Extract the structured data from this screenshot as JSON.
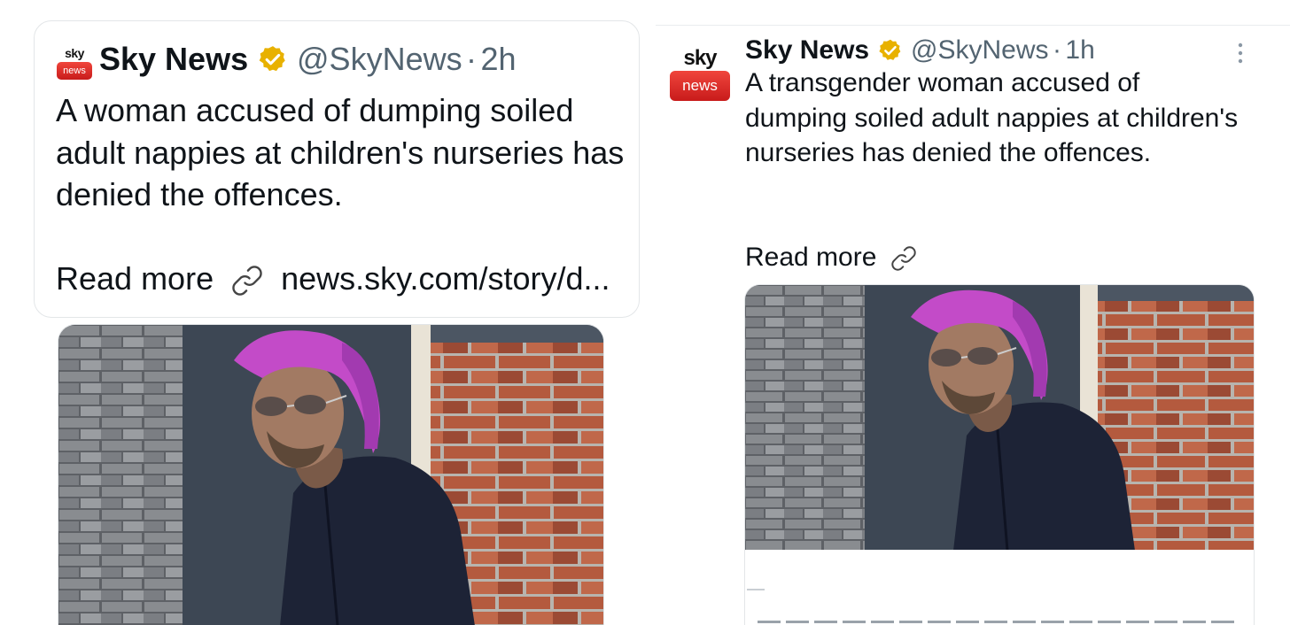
{
  "left_tweet": {
    "logo": {
      "top": "sky",
      "bottom": "news"
    },
    "name": "Sky News",
    "verified_icon": "verified-badge-icon",
    "handle": "@SkyNews",
    "separator": "·",
    "time": "2h",
    "text": "A woman accused of dumping soiled adult nappies at children's nurseries has denied the offences.",
    "read_more": "Read more",
    "link_icon": "link-icon",
    "link_text": "news.sky.com/story/d..."
  },
  "right_tweet": {
    "logo": {
      "top": "sky",
      "bottom": "news"
    },
    "name": "Sky News",
    "verified_icon": "verified-badge-icon",
    "handle": "@SkyNews",
    "separator": "·",
    "time": "1h",
    "more_icon": "more-options-icon",
    "text": "A transgender woman accused of dumping soiled adult nappies at children's nurseries has denied the offences.",
    "read_more": "Read more",
    "link_icon": "link-icon"
  },
  "colors": {
    "text": "#0f1419",
    "secondary": "#536471",
    "verified_gold": "#e8b100",
    "sky_red": "#d92b2b",
    "card_border": "#e3e6e8"
  }
}
